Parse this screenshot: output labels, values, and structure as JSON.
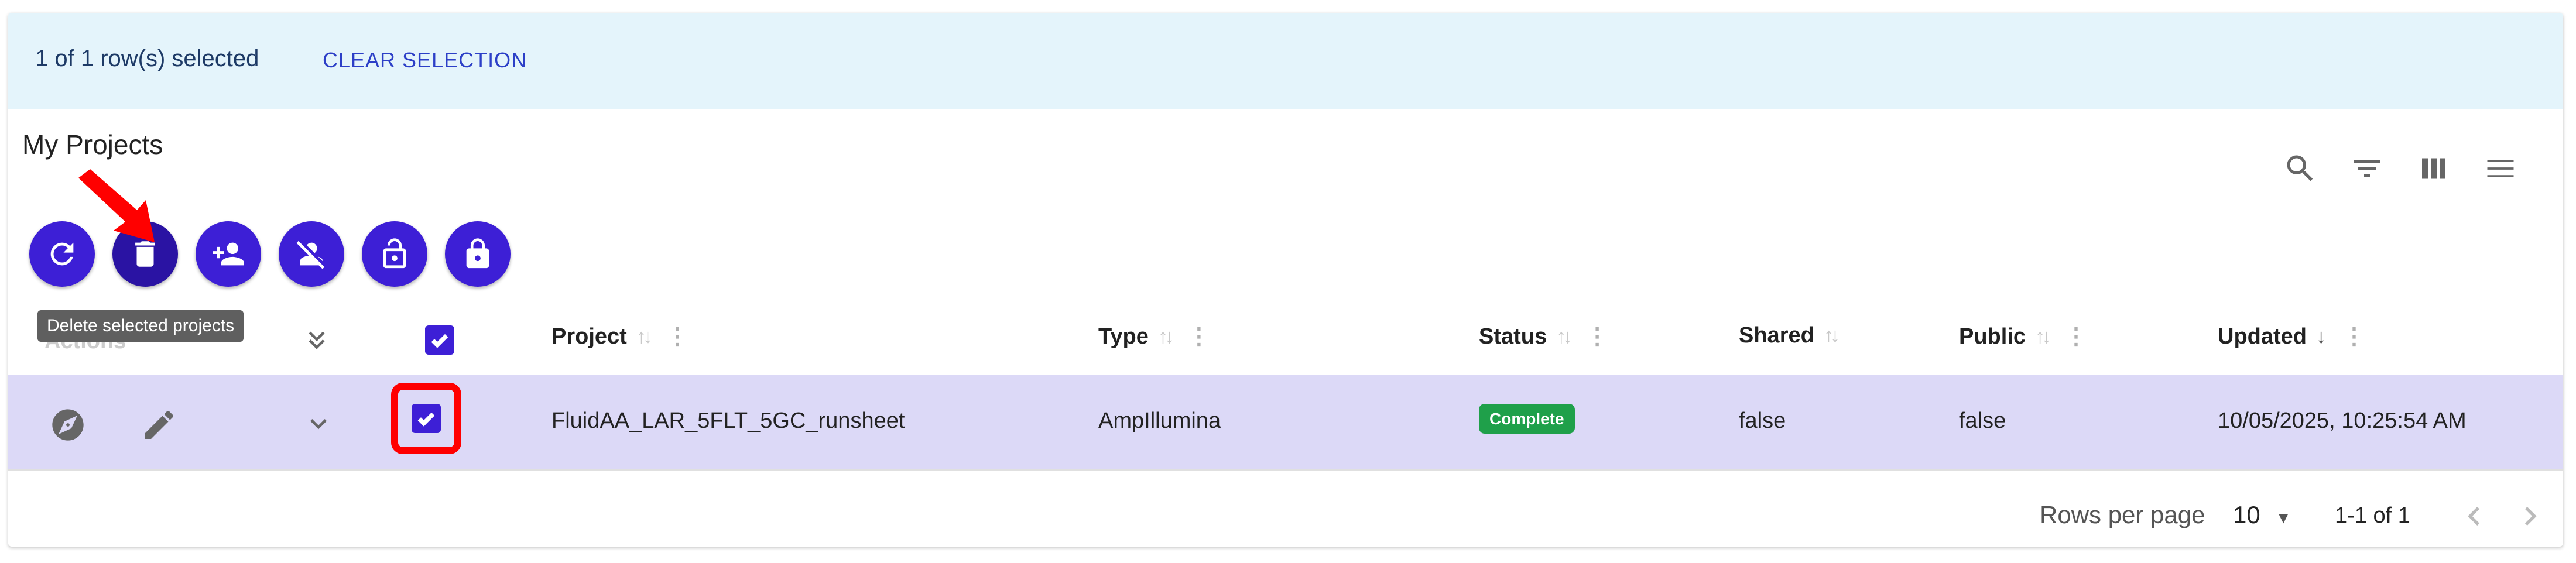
{
  "selection": {
    "count_text": "1 of 1 row(s) selected",
    "clear_label": "CLEAR SELECTION"
  },
  "title": "My Projects",
  "toolbar": {
    "icons": [
      "search-icon",
      "filter-icon",
      "columns-icon",
      "menu-icon"
    ]
  },
  "actions": {
    "buttons": [
      "refresh-icon",
      "trash-icon",
      "person-add-icon",
      "person-off-icon",
      "lock-open-icon",
      "lock-icon"
    ]
  },
  "tooltip": "Delete selected projects",
  "table": {
    "headers": {
      "hidden": "Actions",
      "project": "Project",
      "type": "Type",
      "status": "Status",
      "shared": "Shared",
      "public": "Public",
      "updated": "Updated"
    },
    "rows": [
      {
        "project": "FluidAA_LAR_5FLT_5GC_runsheet",
        "type": "AmpIllumina",
        "status": "Complete",
        "shared": "false",
        "public": "false",
        "updated": "10/05/2025, 10:25:54 AM"
      }
    ]
  },
  "footer": {
    "rows_per_page_label": "Rows per page",
    "rows_per_page_value": "10",
    "range": "1-1 of 1"
  },
  "colors": {
    "accent": "#3d1fd6",
    "selected_row": "#dcd9f7",
    "selection_bar": "#e4f4fb",
    "status_complete": "#1fa04a",
    "highlight_red": "#ff0000"
  }
}
